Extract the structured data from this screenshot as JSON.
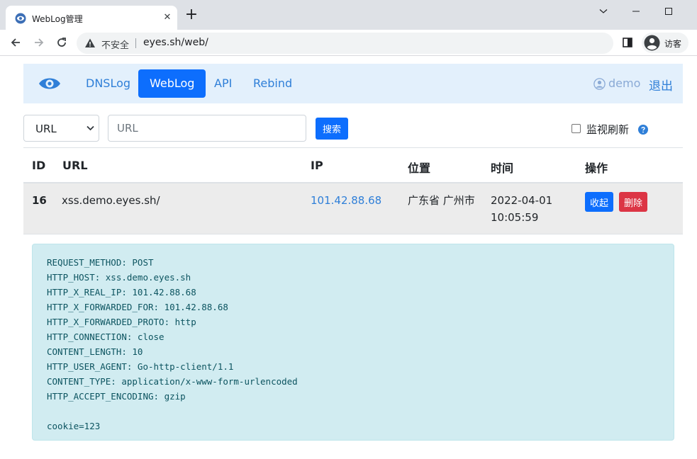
{
  "browser": {
    "tab_title": "WebLog管理",
    "tab_close": "✕",
    "new_tab": "+",
    "security_label": "不安全",
    "url": "eyes.sh/web/",
    "profile_label": "访客"
  },
  "navbar": {
    "links": [
      {
        "label": "DNSLog",
        "active": false
      },
      {
        "label": "WebLog",
        "active": true
      },
      {
        "label": "API",
        "active": false
      },
      {
        "label": "Rebind",
        "active": false
      }
    ],
    "user": "demo",
    "logout": "退出"
  },
  "filter": {
    "select_value": "URL",
    "search_placeholder": "URL",
    "search_value": "",
    "search_button": "搜索",
    "monitor_label": "监视刷新",
    "monitor_checked": false
  },
  "table": {
    "headers": [
      "ID",
      "URL",
      "IP",
      "位置",
      "时间",
      "操作"
    ],
    "rows": [
      {
        "id": "16",
        "url": "xss.demo.eyes.sh/",
        "ip": "101.42.88.68",
        "location": "广东省 广州市",
        "time": "2022-04-01 10:05:59",
        "collapse_label": "收起",
        "delete_label": "删除"
      }
    ]
  },
  "detail": {
    "lines": [
      "REQUEST_METHOD: POST",
      "HTTP_HOST: xss.demo.eyes.sh",
      "HTTP_X_REAL_IP: 101.42.88.68",
      "HTTP_X_FORWARDED_FOR: 101.42.88.68",
      "HTTP_X_FORWARDED_PROTO: http",
      "HTTP_CONNECTION: close",
      "CONTENT_LENGTH: 10",
      "HTTP_USER_AGENT: Go-http-client/1.1",
      "CONTENT_TYPE: application/x-www-form-urlencoded",
      "HTTP_ACCEPT_ENCODING: gzip",
      "",
      "cookie=123"
    ]
  },
  "colors": {
    "primary": "#0d6efd",
    "danger": "#dc3545",
    "link": "#2f7fd8",
    "navbar_bg": "#e3f0fc",
    "detail_bg": "#d1ecf1",
    "detail_text": "#0c5460"
  },
  "icons": {
    "favicon": "eye-icon",
    "brand": "eye-icon",
    "user": "user-circle-icon",
    "help": "question-circle-icon",
    "security": "warning-triangle-icon"
  }
}
